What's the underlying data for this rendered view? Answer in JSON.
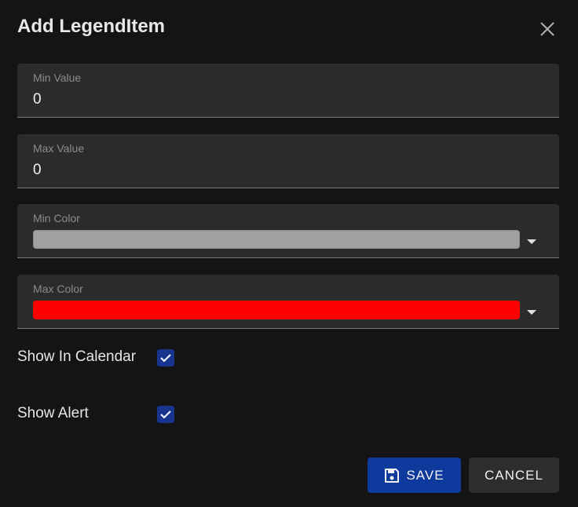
{
  "dialog": {
    "title": "Add LegendItem",
    "close_icon": "close-icon"
  },
  "fields": {
    "min_value": {
      "label": "Min Value",
      "value": "0"
    },
    "max_value": {
      "label": "Max Value",
      "value": "0"
    },
    "min_color": {
      "label": "Min Color",
      "color": "#a0a0a0"
    },
    "max_color": {
      "label": "Max Color",
      "color": "#ff0000"
    }
  },
  "options": {
    "show_in_calendar": {
      "label": "Show In Calendar",
      "checked": true
    },
    "show_alert": {
      "label": "Show Alert",
      "checked": true
    }
  },
  "actions": {
    "save_label": "SAVE",
    "save_icon": "save-icon",
    "cancel_label": "CANCEL"
  },
  "colors": {
    "background": "#141414",
    "field_bg": "#2b2b2b",
    "primary": "#0e3a9e",
    "checkbox": "#17358e"
  }
}
